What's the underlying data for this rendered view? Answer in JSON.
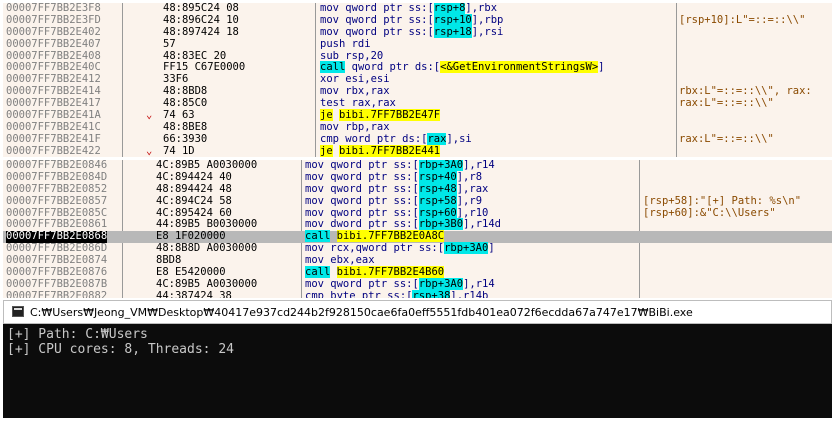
{
  "pane1": {
    "rows": [
      {
        "addr": "00007FF7BB2E3F8",
        "arrow": "",
        "bytes": "48:895C24 08",
        "dis": "mov qword ptr ss:[rsp+8],rbx",
        "cmt": ""
      },
      {
        "addr": "00007FF7BB2E3FD",
        "arrow": "",
        "bytes": "48:896C24 10",
        "dis": "mov qword ptr ss:[rsp+10],rbp",
        "cmt": "[rsp+10]:L\"=::=::\\\\\""
      },
      {
        "addr": "00007FF7BB2E402",
        "arrow": "",
        "bytes": "48:897424 18",
        "dis": "mov qword ptr ss:[rsp+18],rsi",
        "cmt": ""
      },
      {
        "addr": "00007FF7BB2E407",
        "arrow": "",
        "bytes": "57",
        "dis": "push rdi",
        "cmt": ""
      },
      {
        "addr": "00007FF7BB2E408",
        "arrow": "",
        "bytes": "48:83EC 20",
        "dis": "sub rsp,20",
        "cmt": ""
      },
      {
        "addr": "00007FF7BB2E40C",
        "arrow": "",
        "bytes": "FF15 C67E0000",
        "dis": "call qword ptr ds:[<&GetEnvironmentStringsW>]",
        "cmt": ""
      },
      {
        "addr": "00007FF7BB2E412",
        "arrow": "",
        "bytes": "33F6",
        "dis": "xor esi,esi",
        "cmt": ""
      },
      {
        "addr": "00007FF7BB2E414",
        "arrow": "",
        "bytes": "48:8BD8",
        "dis": "mov rbx,rax",
        "cmt": "rbx:L\"=::=::\\\\\", rax:"
      },
      {
        "addr": "00007FF7BB2E417",
        "arrow": "",
        "bytes": "48:85C0",
        "dis": "test rax,rax",
        "cmt": "rax:L\"=::=::\\\\\""
      },
      {
        "addr": "00007FF7BB2E41A",
        "arrow": "⌄",
        "bytes": "74 63",
        "dis": "je bibi.7FF7BB2E47F",
        "cmt": ""
      },
      {
        "addr": "00007FF7BB2E41C",
        "arrow": "",
        "bytes": "48:8BE8",
        "dis": "mov rbp,rax",
        "cmt": ""
      },
      {
        "addr": "00007FF7BB2E41F",
        "arrow": "",
        "bytes": "66:3930",
        "dis": "cmp word ptr ds:[rax],si",
        "cmt": "rax:L\"=::=::\\\\\""
      },
      {
        "addr": "00007FF7BB2E422",
        "arrow": "⌄",
        "bytes": "74 1D",
        "dis": "je bibi.7FF7BB2E441",
        "cmt": ""
      }
    ]
  },
  "pane2": {
    "rows": [
      {
        "addr": "00007FF7BB2E0846",
        "bytes": "4C:89B5 A0030000",
        "dis": "mov qword ptr ss:[rbp+3A0],r14",
        "cmt": ""
      },
      {
        "addr": "00007FF7BB2E084D",
        "bytes": "4C:894424 40",
        "dis": "mov qword ptr ss:[rsp+40],r8",
        "cmt": ""
      },
      {
        "addr": "00007FF7BB2E0852",
        "bytes": "48:894424 48",
        "dis": "mov qword ptr ss:[rsp+48],rax",
        "cmt": ""
      },
      {
        "addr": "00007FF7BB2E0857",
        "bytes": "4C:894C24 58",
        "dis": "mov qword ptr ss:[rsp+58],r9",
        "cmt": "[rsp+58]:\"[+] Path: %s\\n\""
      },
      {
        "addr": "00007FF7BB2E085C",
        "bytes": "4C:895424 60",
        "dis": "mov qword ptr ss:[rsp+60],r10",
        "cmt": "[rsp+60]:&\"C:\\\\Users\""
      },
      {
        "addr": "00007FF7BB2E0861",
        "bytes": "44:89B5 B0030000",
        "dis": "mov dword ptr ss:[rbp+3B0],r14d",
        "cmt": ""
      },
      {
        "addr": "00007FF7BB2E0868",
        "bytes": "E8 1F020000",
        "dis": "call bibi.7FF7BB2E0A8C",
        "cmt": ""
      },
      {
        "addr": "00007FF7BB2E086D",
        "bytes": "48:8B8D A0030000",
        "dis": "mov rcx,qword ptr ss:[rbp+3A0]",
        "cmt": ""
      },
      {
        "addr": "00007FF7BB2E0874",
        "bytes": "8BD8",
        "dis": "mov ebx,eax",
        "cmt": ""
      },
      {
        "addr": "00007FF7BB2E0876",
        "bytes": "E8 E5420000",
        "dis": "call bibi.7FF7BB2E4B60",
        "cmt": ""
      },
      {
        "addr": "00007FF7BB2E087B",
        "bytes": "4C:89B5 A0030000",
        "dis": "mov qword ptr ss:[rbp+3A0],r14",
        "cmt": ""
      },
      {
        "addr": "00007FF7BB2E0882",
        "bytes": "44:387424 38",
        "dis": "cmp byte ptr ss:[rsp+38],r14b",
        "cmt": ""
      }
    ]
  },
  "console": {
    "title": "C:₩Users₩Jeong_VM₩Desktop₩40417e937cd244b2f928150cae6fa0eff5551fdb401ea072f6ecdda67a747e17₩BiBi.exe",
    "lines": [
      "[+] Path: C:₩Users",
      "[+] CPU cores: 8, Threads: 24"
    ]
  }
}
